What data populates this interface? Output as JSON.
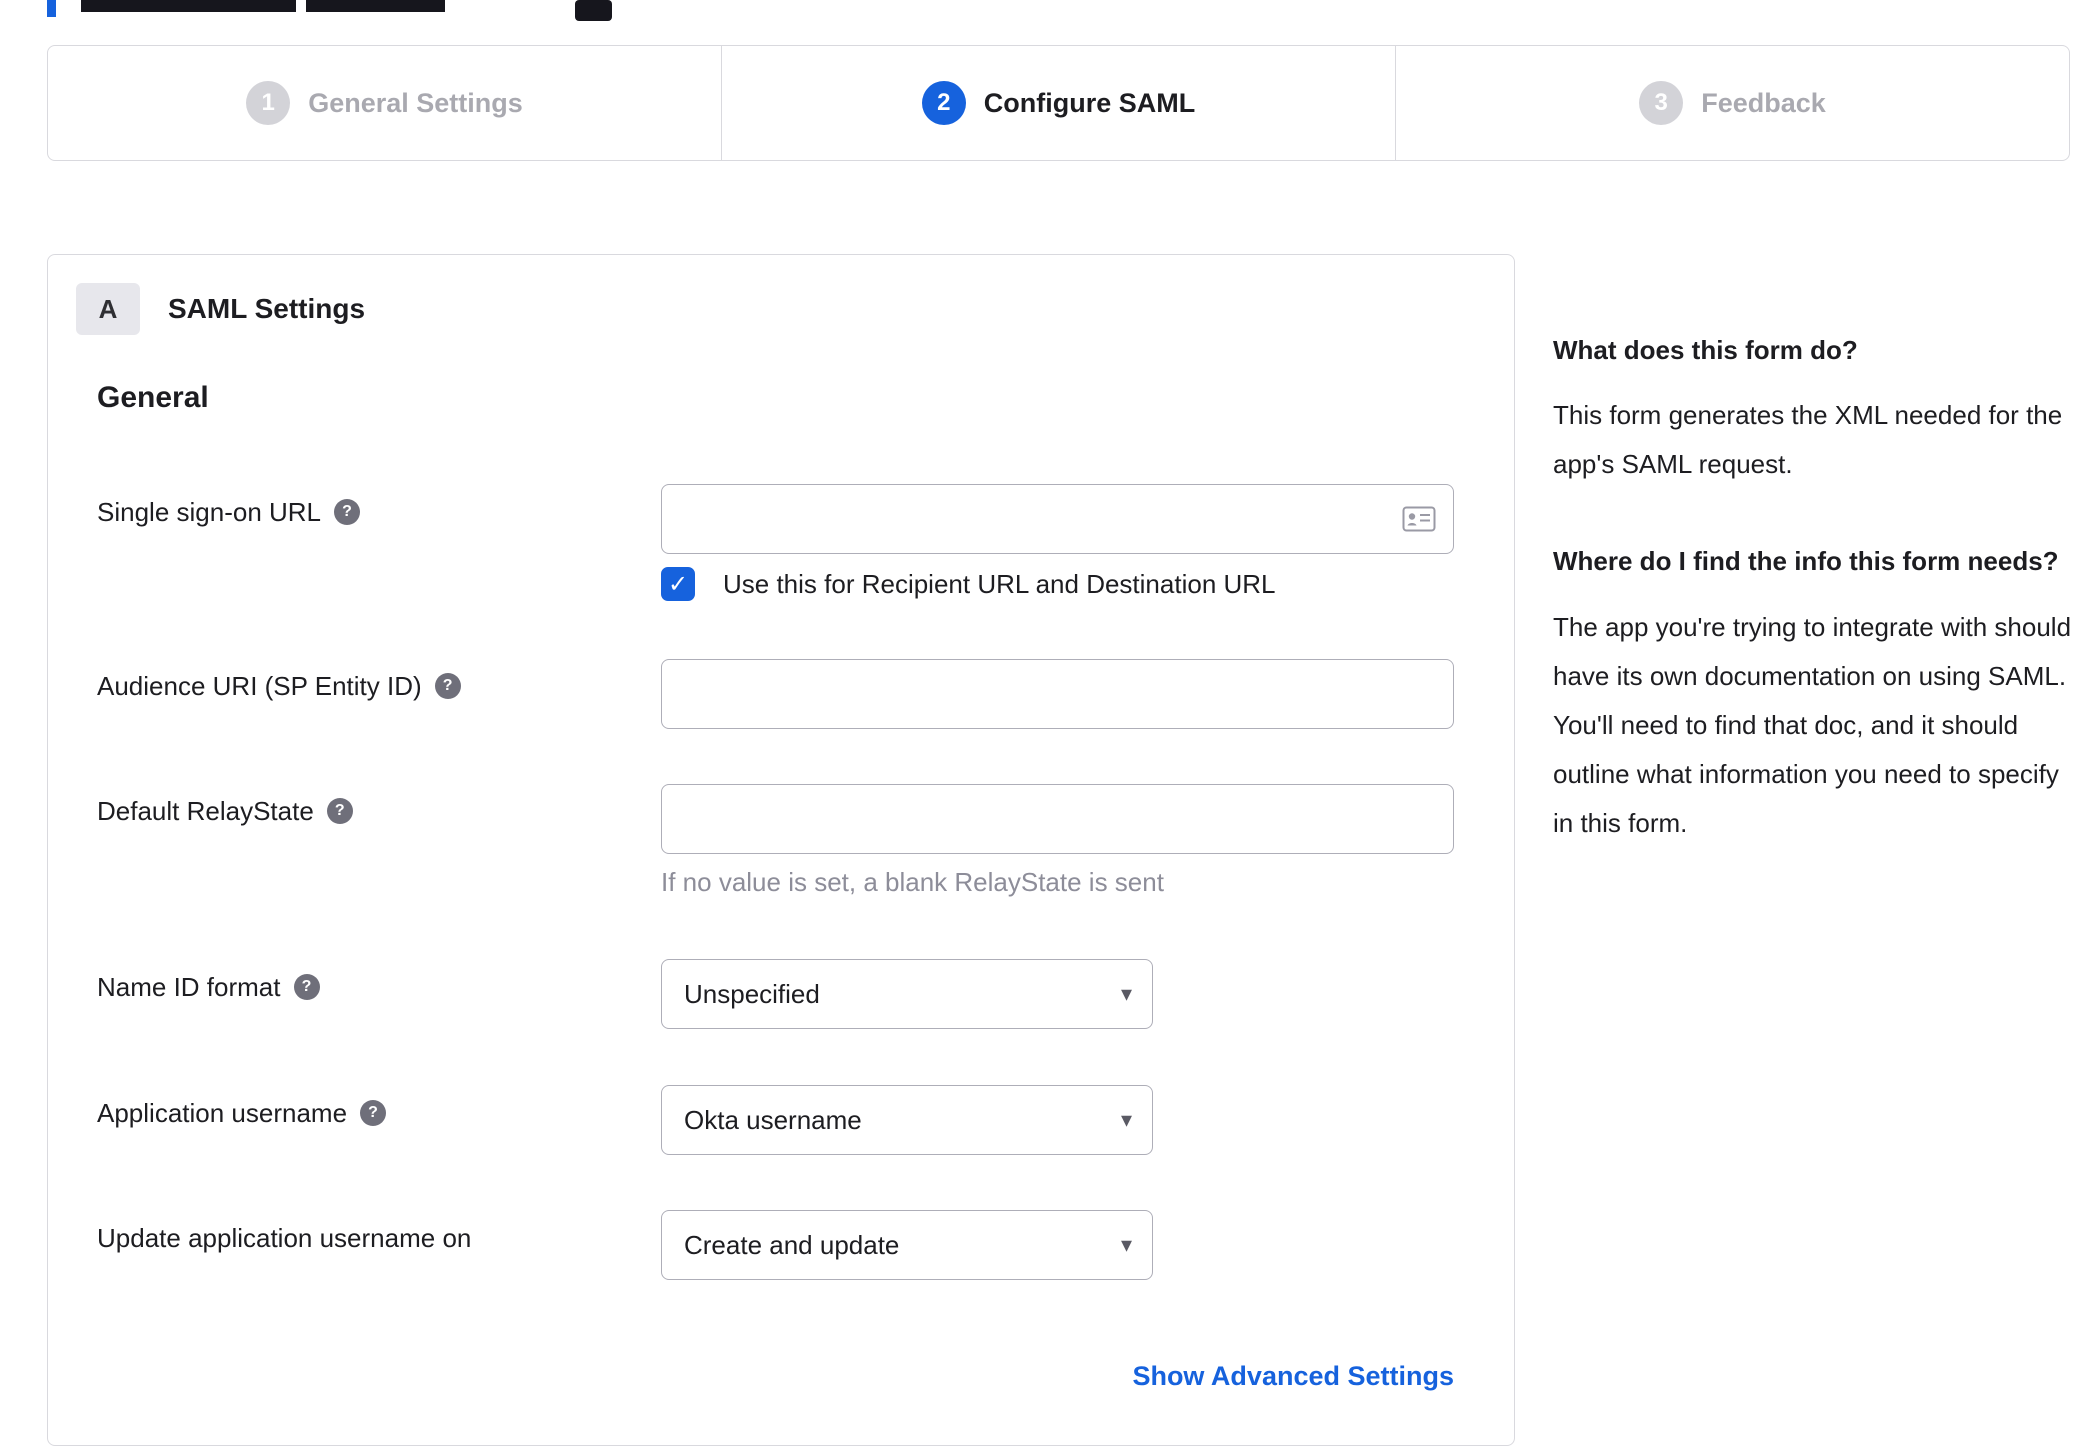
{
  "stepper": {
    "steps": [
      {
        "number": "1",
        "label": "General Settings",
        "state": "inactive"
      },
      {
        "number": "2",
        "label": "Configure SAML",
        "state": "active"
      },
      {
        "number": "3",
        "label": "Feedback",
        "state": "inactive"
      }
    ]
  },
  "panel": {
    "badge": "A",
    "title": "SAML Settings",
    "section": "General",
    "sso": {
      "label": "Single sign-on URL",
      "value": "",
      "checkbox_label": "Use this for Recipient URL and Destination URL",
      "checked": true
    },
    "audience": {
      "label": "Audience URI (SP Entity ID)",
      "value": ""
    },
    "relay": {
      "label": "Default RelayState",
      "value": "",
      "hint": "If no value is set, a blank RelayState is sent"
    },
    "name_id": {
      "label": "Name ID format",
      "value": "Unspecified"
    },
    "app_username": {
      "label": "Application username",
      "value": "Okta username"
    },
    "update_username": {
      "label": "Update application username on",
      "value": "Create and update"
    },
    "advanced_link": "Show Advanced Settings"
  },
  "sidebar": {
    "heading1": "What does this form do?",
    "body1": "This form generates the XML needed for the app's SAML request.",
    "heading2": "Where do I find the info this form needs?",
    "body2": "The app you're trying to integrate with should have its own documentation on using SAML. You'll need to find that doc, and it should outline what information you need to specify in this form."
  },
  "icons": {
    "help_icon": "?",
    "caret_icon": "▾",
    "check_icon": "✓"
  },
  "colors": {
    "accent": "#1662dd",
    "link": "#1662dd",
    "text": "#1d1d21",
    "muted": "#8d8d99",
    "border": "#d9d9de",
    "input_border": "#aeaeb8"
  }
}
